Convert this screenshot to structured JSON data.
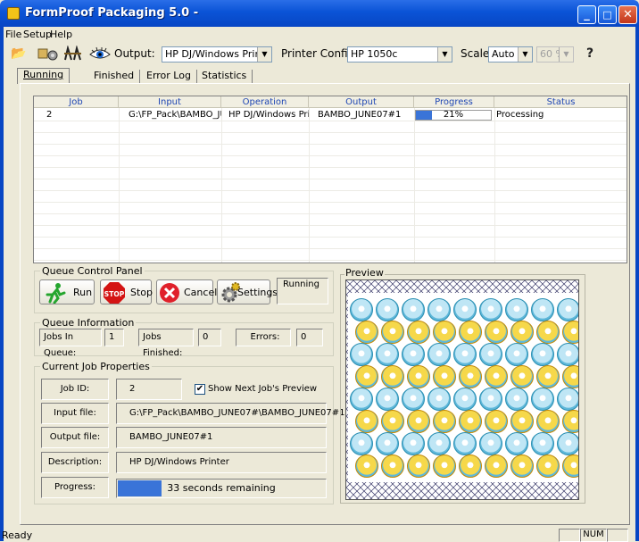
{
  "window": {
    "title": "FormProof Packaging 5.0 -",
    "minimize": "_",
    "maximize": "□",
    "close": "✕"
  },
  "menu": {
    "items": [
      "File",
      "Setup",
      "Help"
    ]
  },
  "toolbar": {
    "output_label": "Output:",
    "output_value": "HP DJ/Windows Printer",
    "printer_config_label": "Printer Config:",
    "printer_config_value": "HP 1050c",
    "scale_label": "Scale:",
    "scale_value": "Auto",
    "scale_percent": "60 %",
    "help_glyph": "?"
  },
  "tabs": [
    "Running",
    "Finished",
    "Error Log",
    "Statistics"
  ],
  "jobs_table": {
    "columns": [
      "Job",
      "Input",
      "Operation",
      "Output",
      "Progress",
      "Status"
    ],
    "rows": [
      {
        "job": "2",
        "input": "G:\\FP_Pack\\BAMBO_JUNE(",
        "operation": "HP DJ/Windows Printer",
        "output": "BAMBO_JUNE07#1",
        "progress": "21%",
        "progress_fraction": 0.21,
        "status": "Processing"
      }
    ]
  },
  "queue_control": {
    "title": "Queue Control Panel",
    "run": "Run",
    "stop": "Stop",
    "stop_sign": "STOP",
    "cancel": "Cancel",
    "settings": "Settings",
    "state": "Running"
  },
  "queue_info": {
    "title": "Queue Information",
    "jobs_in_queue_label": "Jobs In Queue:",
    "jobs_in_queue": "1",
    "jobs_finished_label": "Jobs Finished:",
    "jobs_finished": "0",
    "errors_label": "Errors:",
    "errors": "0"
  },
  "current_job": {
    "title": "Current Job Properties",
    "job_id_label": "Job ID:",
    "job_id": "2",
    "show_preview_label": "Show Next Job's Preview",
    "input_label": "Input file:",
    "input_file": "G:\\FP_Pack\\BAMBO_JUNE07#\\BAMBO_JUNE07#1",
    "output_label": "Output file:",
    "output_file": "BAMBO_JUNE07#1",
    "description_label": "Description:",
    "description": "HP DJ/Windows Printer",
    "progress_label": "Progress:",
    "progress_fraction": 0.21,
    "remaining": "33 seconds remaining"
  },
  "preview": {
    "title": "Preview"
  },
  "statusbar": {
    "left": "Ready",
    "num": "NUM"
  },
  "colors": {
    "titlebar": "#0a53d6",
    "progress": "#3a74d8",
    "header_text": "#1e46b4"
  }
}
